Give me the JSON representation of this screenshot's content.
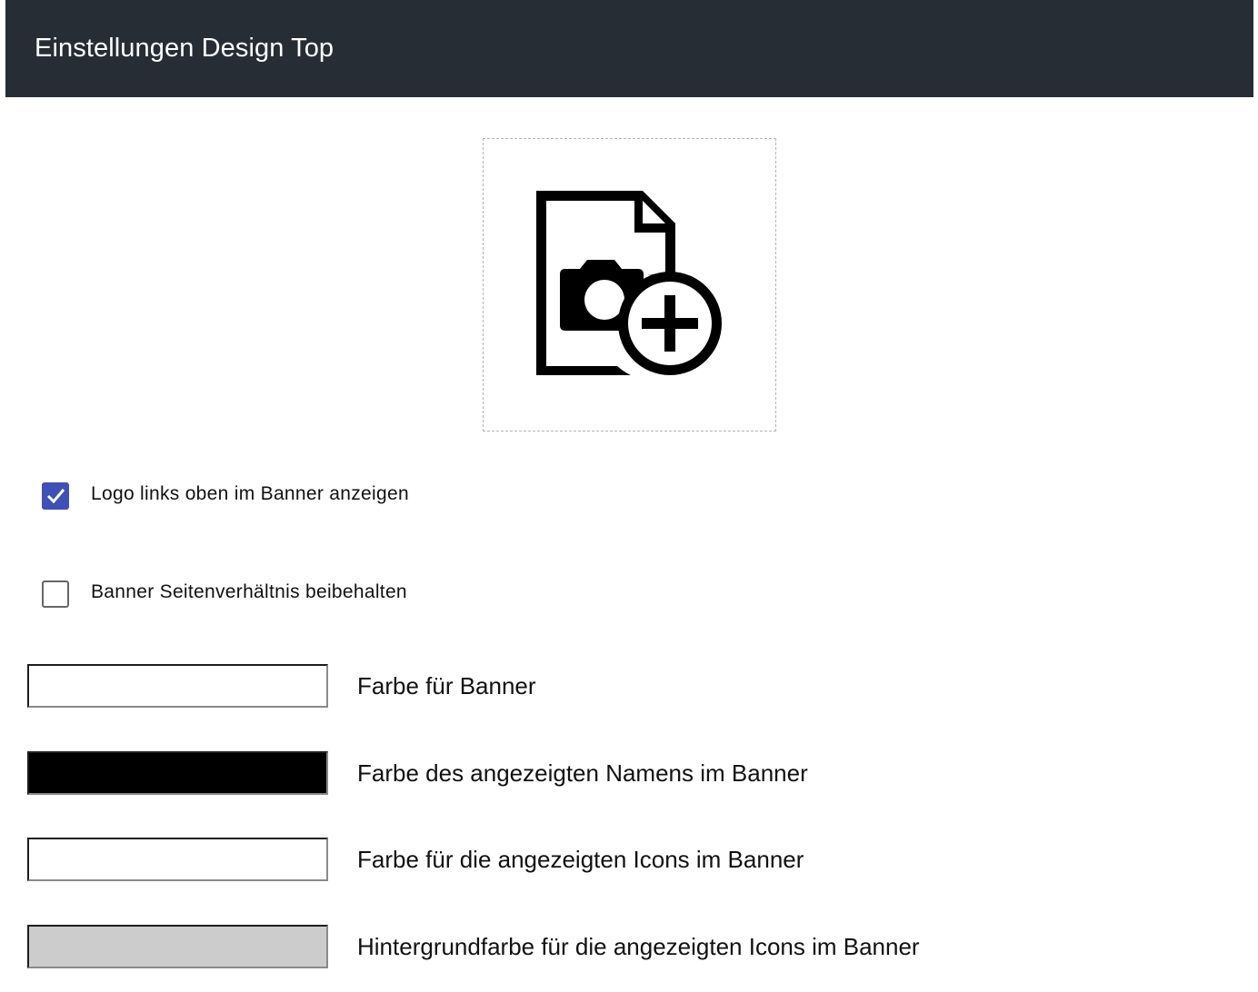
{
  "header": {
    "title": "Einstellungen Design Top"
  },
  "upload": {
    "icon": "image-add-icon"
  },
  "options": [
    {
      "label": "Logo links oben im Banner anzeigen",
      "checked": true
    },
    {
      "label": "Banner Seitenverhältnis beibehalten",
      "checked": false
    }
  ],
  "colors": [
    {
      "label": "Farbe für Banner",
      "value": "#ffffff"
    },
    {
      "label": "Farbe des angezeigten Namens im Banner",
      "value": "#000000"
    },
    {
      "label": "Farbe für die angezeigten Icons im Banner",
      "value": "#ffffff"
    },
    {
      "label": "Hintergrundfarbe für die angezeigten Icons im Banner",
      "value": "#cccccc"
    }
  ],
  "theme": {
    "header_bg": "#262d35",
    "header_text": "#ffffff",
    "checkbox_accent": "#3f51b5"
  }
}
